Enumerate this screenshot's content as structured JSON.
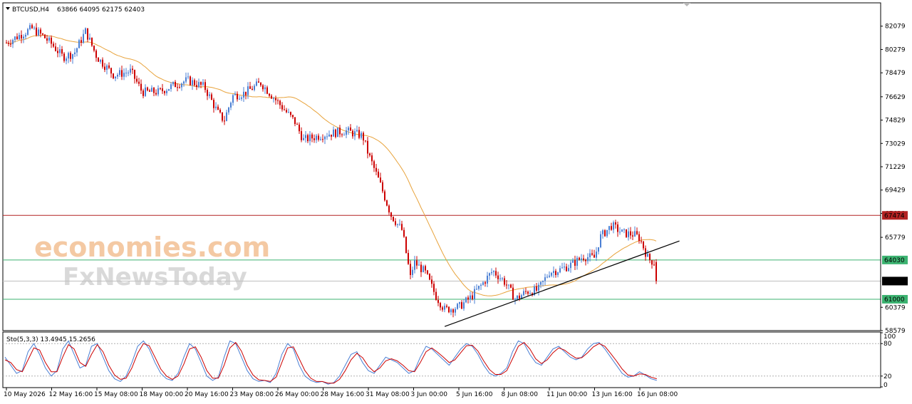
{
  "header": {
    "symbol_timeframe": "BTCUSD,H4",
    "ohlc": "63866 64095 62175 62403"
  },
  "watermark": {
    "line1": "economies.com",
    "line2": "FxNewsToday"
  },
  "chart_data": [
    {
      "type": "candlestick",
      "title": "BTCUSD,H4",
      "ylim": [
        58579,
        83879
      ],
      "y_ticks": [
        "82079",
        "80279",
        "78479",
        "76629",
        "74829",
        "73029",
        "71229",
        "69429",
        "67629",
        "65779",
        "64030",
        "62403",
        "60379",
        "58579"
      ],
      "x_ticks": [
        "10 May 2026",
        "12 May 16:00",
        "15 May 08:00",
        "18 May 00:00",
        "20 May 16:00",
        "23 May 08:00",
        "26 May 00:00",
        "28 May 16:00",
        "31 May 08:00",
        "3 Jun 00:00",
        "5 Jun 16:00",
        "8 Jun 08:00",
        "11 Jun 00:00",
        "13 Jun 16:00",
        "16 Jun 08:00"
      ],
      "last_price": {
        "label": "62403",
        "value": 62403
      },
      "horizontal_levels": [
        {
          "label": "67474",
          "value": 67474,
          "color": "#b22222"
        },
        {
          "label": "64030",
          "value": 64030,
          "color": "#3cb371"
        },
        {
          "label": "61000",
          "value": 61000,
          "color": "#3cb371"
        }
      ],
      "trendline": {
        "from": {
          "x": "4 Jun 20:00",
          "y": 58900
        },
        "to": {
          "x": "18 Jun 16:00",
          "y": 65500
        },
        "color": "#000000"
      },
      "moving_average": {
        "color": "#e8a33c"
      },
      "close_path": [
        {
          "x": "10 May 2026",
          "y": 80800
        },
        {
          "x": "11 May 12:00",
          "y": 81900
        },
        {
          "x": "12 May 04:00",
          "y": 81300
        },
        {
          "x": "12 May 16:00",
          "y": 80700
        },
        {
          "x": "13 May 08:00",
          "y": 79700
        },
        {
          "x": "14 May 00:00",
          "y": 80000
        },
        {
          "x": "14 May 16:00",
          "y": 81700
        },
        {
          "x": "15 May 08:00",
          "y": 79700
        },
        {
          "x": "16 May 08:00",
          "y": 78300
        },
        {
          "x": "17 May 08:00",
          "y": 78600
        },
        {
          "x": "18 May 00:00",
          "y": 77000
        },
        {
          "x": "19 May 00:00",
          "y": 77000
        },
        {
          "x": "20 May 00:00",
          "y": 77600
        },
        {
          "x": "20 May 16:00",
          "y": 77900
        },
        {
          "x": "21 May 16:00",
          "y": 77400
        },
        {
          "x": "22 May 12:00",
          "y": 75300
        },
        {
          "x": "22 May 20:00",
          "y": 74800
        },
        {
          "x": "23 May 08:00",
          "y": 76700
        },
        {
          "x": "24 May 00:00",
          "y": 76900
        },
        {
          "x": "25 May 00:00",
          "y": 77700
        },
        {
          "x": "26 May 00:00",
          "y": 76200
        },
        {
          "x": "27 May 00:00",
          "y": 74700
        },
        {
          "x": "27 May 12:00",
          "y": 73300
        },
        {
          "x": "28 May 16:00",
          "y": 73700
        },
        {
          "x": "30 May 00:00",
          "y": 74000
        },
        {
          "x": "31 May 00:00",
          "y": 73600
        },
        {
          "x": "31 May 08:00",
          "y": 72200
        },
        {
          "x": "1 Jun 00:00",
          "y": 70000
        },
        {
          "x": "1 Jun 16:00",
          "y": 67500
        },
        {
          "x": "2 Jun 08:00",
          "y": 66300
        },
        {
          "x": "2 Jun 20:00",
          "y": 62500
        },
        {
          "x": "3 Jun 00:00",
          "y": 63900
        },
        {
          "x": "3 Jun 16:00",
          "y": 63100
        },
        {
          "x": "4 Jun 08:00",
          "y": 61200
        },
        {
          "x": "4 Jun 20:00",
          "y": 60200
        },
        {
          "x": "5 Jun 16:00",
          "y": 60400
        },
        {
          "x": "6 Jun 08:00",
          "y": 61100
        },
        {
          "x": "7 Jun 00:00",
          "y": 62100
        },
        {
          "x": "7 Jun 16:00",
          "y": 63200
        },
        {
          "x": "8 Jun 08:00",
          "y": 62400
        },
        {
          "x": "9 Jun 00:00",
          "y": 61000
        },
        {
          "x": "9 Jun 16:00",
          "y": 61600
        },
        {
          "x": "10 Jun 08:00",
          "y": 61700
        },
        {
          "x": "11 Jun 00:00",
          "y": 63100
        },
        {
          "x": "11 Jun 16:00",
          "y": 63300
        },
        {
          "x": "12 Jun 08:00",
          "y": 63700
        },
        {
          "x": "13 Jun 00:00",
          "y": 64300
        },
        {
          "x": "13 Jun 16:00",
          "y": 64200
        },
        {
          "x": "14 Jun 00:00",
          "y": 65800
        },
        {
          "x": "14 Jun 16:00",
          "y": 66700
        },
        {
          "x": "15 Jun 08:00",
          "y": 66100
        },
        {
          "x": "16 Jun 00:00",
          "y": 66000
        },
        {
          "x": "16 Jun 08:00",
          "y": 65700
        },
        {
          "x": "16 Jun 20:00",
          "y": 64100
        },
        {
          "x": "17 Jun 04:00",
          "y": 63866
        },
        {
          "x": "17 Jun 08:00",
          "y": 62403
        }
      ]
    },
    {
      "type": "line",
      "title": "Sto(5,3,3) 13.4945 15.2656",
      "ylim": [
        0,
        100
      ],
      "y_ticks": [
        "100",
        "80",
        "20",
        "0"
      ],
      "levels": [
        80,
        20
      ],
      "series": [
        {
          "color": "#4a7fd4",
          "values": [
            55,
            40,
            25,
            30,
            65,
            80,
            60,
            35,
            20,
            30,
            70,
            85,
            60,
            35,
            40,
            75,
            80,
            55,
            30,
            15,
            10,
            20,
            45,
            75,
            85,
            70,
            45,
            25,
            15,
            12,
            25,
            55,
            80,
            70,
            45,
            20,
            12,
            18,
            55,
            85,
            80,
            55,
            30,
            15,
            10,
            12,
            8,
            25,
            60,
            80,
            70,
            40,
            20,
            12,
            8,
            10,
            5,
            8,
            20,
            40,
            60,
            65,
            45,
            30,
            25,
            40,
            55,
            50,
            45,
            35,
            25,
            30,
            55,
            75,
            70,
            60,
            50,
            40,
            55,
            70,
            80,
            75,
            60,
            40,
            25,
            20,
            25,
            35,
            65,
            85,
            80,
            60,
            45,
            40,
            55,
            70,
            75,
            65,
            55,
            50,
            55,
            70,
            80,
            82,
            70,
            55,
            40,
            25,
            18,
            20,
            28,
            22,
            15,
            12
          ]
        },
        {
          "color": "#cc0000",
          "values": [
            50,
            45,
            32,
            28,
            50,
            72,
            68,
            45,
            28,
            28,
            55,
            78,
            70,
            45,
            38,
            60,
            78,
            65,
            40,
            22,
            14,
            16,
            35,
            62,
            80,
            76,
            55,
            33,
            20,
            14,
            20,
            42,
            70,
            74,
            55,
            30,
            16,
            16,
            40,
            72,
            82,
            66,
            40,
            22,
            13,
            12,
            10,
            18,
            45,
            72,
            74,
            52,
            30,
            16,
            10,
            10,
            7,
            7,
            14,
            30,
            50,
            62,
            54,
            38,
            28,
            35,
            48,
            52,
            48,
            40,
            30,
            28,
            45,
            65,
            72,
            64,
            55,
            45,
            50,
            63,
            76,
            77,
            66,
            48,
            32,
            23,
            23,
            30,
            52,
            75,
            82,
            70,
            52,
            43,
            50,
            63,
            72,
            68,
            60,
            53,
            54,
            63,
            74,
            80,
            75,
            62,
            48,
            33,
            22,
            20,
            24,
            23,
            18,
            15
          ]
        }
      ]
    }
  ]
}
